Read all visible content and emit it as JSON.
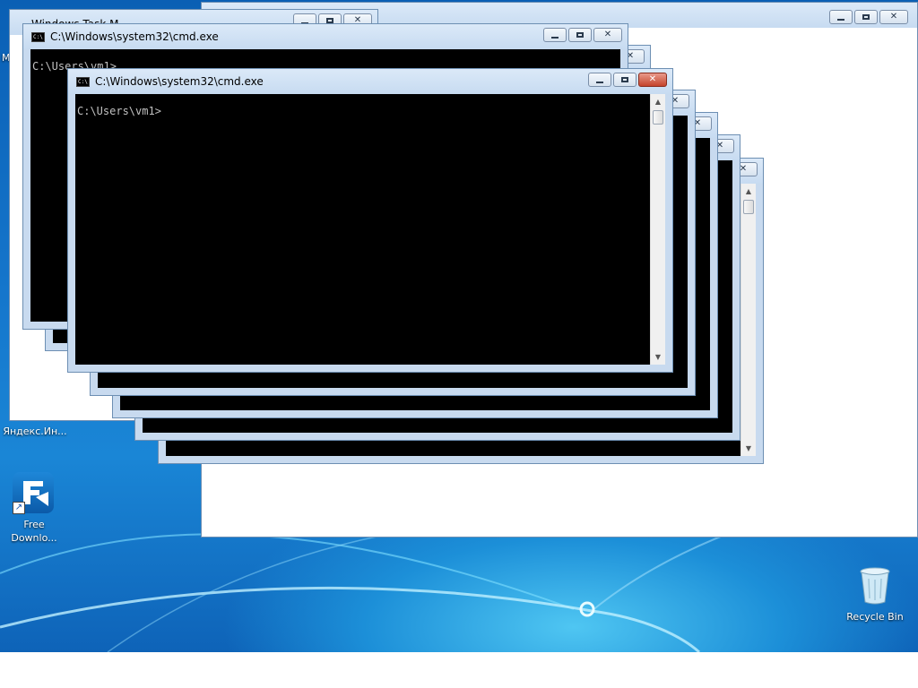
{
  "desktop": {
    "icons": [
      {
        "label": "Яндекс.Ин..."
      },
      {
        "label_line1": "Free",
        "label_line2": "Downlo..."
      },
      {
        "label": "Recycle Bin"
      }
    ],
    "partial_text": "M"
  },
  "windows": {
    "back_title": "Windows Task M...",
    "cmd_title": "C:\\Windows\\system32\\cmd.exe",
    "prompt": "C:\\Users\\vm1>"
  },
  "controls": {
    "minimize": "minimize",
    "maximize": "maximize",
    "close": "✕"
  },
  "colors": {
    "accent": "#1a86d6",
    "close_active": "#c4432b",
    "console_bg": "#000000",
    "console_text": "#c0c0c0"
  }
}
